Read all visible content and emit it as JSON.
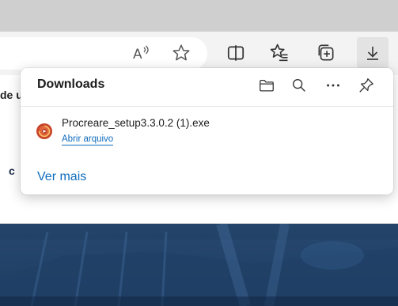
{
  "toolbar": {
    "read_aloud_icon": "read-aloud-icon",
    "favorite_icon": "star-icon",
    "split_screen_icon": "split-screen-icon",
    "favorites_icon": "favorites-icon",
    "collections_icon": "collections-icon",
    "downloads_icon": "download-icon"
  },
  "page": {
    "text_top": "de u",
    "text_mid": "c"
  },
  "downloads": {
    "title": "Downloads",
    "items": [
      {
        "file_name": "Procreare_setup3.3.0.2 (1).exe",
        "action": "Abrir arquivo"
      }
    ],
    "see_more": "Ver mais"
  },
  "colors": {
    "accent": "#0f6cbd",
    "toolbar_bg": "#f3f3f3",
    "tabstrip_bg": "#cfcfcf",
    "hero_bg": "#1e3b5f"
  }
}
